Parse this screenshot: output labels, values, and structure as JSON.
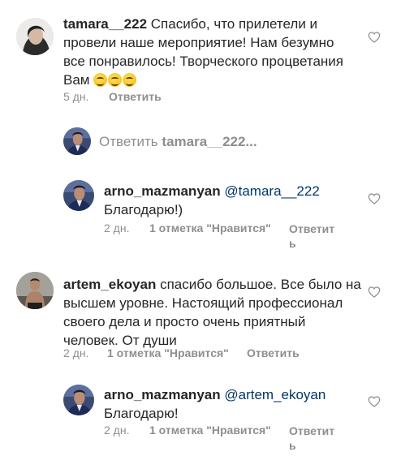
{
  "comments": [
    {
      "username": "tamara__222",
      "text": "Спасибо, что прилетели и",
      "line2": "провели наше мероприятие! Нам безумно",
      "line3": "все понравилось! Творческого процветания",
      "line4": "Вам",
      "time": "5 дн.",
      "reply_label": "Ответить"
    },
    {
      "username": "artem_ekoyan",
      "text": "спасибо большое.  Все было на",
      "line2": "высшем уровне.  Настоящий профессионал",
      "line3": "своего дела и просто очень приятный",
      "line4": "человек.  От души",
      "time": "2 дн.",
      "likes": "1 отметка \"Нравится\"",
      "reply_label": "Ответить"
    }
  ],
  "reply_input": {
    "prefix": "Ответить",
    "target": "tamara__222..."
  },
  "replies": [
    {
      "username": "arno_mazmanyan",
      "mention": "@tamara__222",
      "text": "Благодарю!)",
      "time": "2 дн.",
      "likes": "1 отметка \"Нравится\"",
      "reply_line1": "Ответит",
      "reply_line2": "ь"
    },
    {
      "username": "arno_mazmanyan",
      "mention": "@artem_ekoyan",
      "text": "Благодарю!",
      "time": "2 дн.",
      "likes": "1 отметка \"Нравится\"",
      "reply_line1": "Ответит",
      "reply_line2": "ь"
    }
  ],
  "colors": {
    "text": "#262626",
    "muted": "#8e8e8e",
    "link": "#00376b"
  },
  "icons": [
    "heart-icon",
    "avatar"
  ]
}
